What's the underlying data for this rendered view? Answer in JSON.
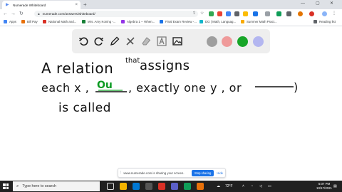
{
  "browser": {
    "tab_title": "Numerade Whiteboard",
    "new_tab_symbol": "+",
    "close_symbol": "×",
    "minimize_symbol": "—",
    "maximize_symbol": "▢",
    "window_close_symbol": "✕",
    "url": "numerade.com/answers/whiteboard/",
    "bookmarks": [
      {
        "label": "Apps",
        "icon_color": "#4285f4"
      },
      {
        "label": "Bill Pay",
        "icon_color": "#e8710a"
      },
      {
        "label": "National Math and...",
        "icon_color": "#d93025"
      },
      {
        "label": "Mrs. Amy Koning -...",
        "icon_color": "#188038"
      },
      {
        "label": "Algebra 1 -- When...",
        "icon_color": "#9334e6"
      },
      {
        "label": "Final Exam Review -...",
        "icon_color": "#1a73e8"
      },
      {
        "label": "DG | Math, Languag...",
        "icon_color": "#12b5cb"
      },
      {
        "label": "Summer Math Pract...",
        "icon_color": "#f9ab00"
      }
    ],
    "reading_list": "Reading list"
  },
  "whiteboard": {
    "tools": [
      "undo-icon",
      "redo-icon",
      "pen-icon",
      "tools-icon",
      "eraser-icon",
      "text-icon",
      "image-icon"
    ],
    "colors": [
      "#9e9e9e",
      "#ef9a9a",
      "#17a528",
      "#b3b6f0"
    ],
    "handwriting": {
      "line1_a": "A relation",
      "line1_superscript": "that",
      "line1_b": "assigns",
      "line2_a": "each x ,",
      "line2_answer": "Ou",
      "line2_b": ", exactly one y , or",
      "line2_end": ")",
      "line3": "is called"
    }
  },
  "share_banner": {
    "text": "www.numerade.com is sharing your screen.",
    "stop_label": "Stop sharing",
    "hide_label": "Hide"
  },
  "taskbar": {
    "search_placeholder": "Type here to search",
    "weather": "72°F",
    "time": "5:07 PM",
    "date": "10/17/2021"
  }
}
